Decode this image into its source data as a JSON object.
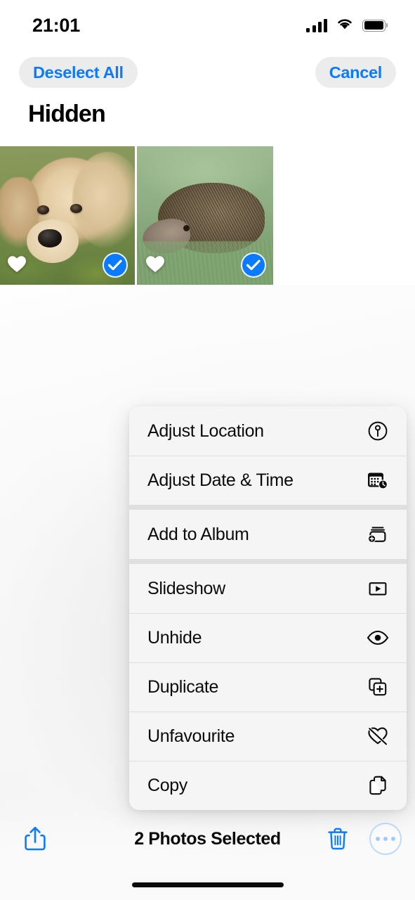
{
  "status_bar": {
    "time": "21:01",
    "cellular_icon": "signal-bars-icon",
    "wifi_icon": "wifi-icon",
    "battery_icon": "battery-full-icon"
  },
  "navbar": {
    "deselect_all_label": "Deselect All",
    "cancel_label": "Cancel"
  },
  "page": {
    "title": "Hidden"
  },
  "photo_grid": {
    "photos": [
      {
        "subject": "golden retriever puppy lying on grass",
        "favourite": true,
        "favourite_icon": "heart-filled-icon",
        "selected": true,
        "selected_icon": "checkmark-circle-icon"
      },
      {
        "subject": "hedgehog foraging in green grass",
        "favourite": true,
        "favourite_icon": "heart-filled-icon",
        "selected": true,
        "selected_icon": "checkmark-circle-icon"
      }
    ]
  },
  "context_menu": {
    "groups": [
      {
        "items": [
          {
            "label": "Adjust Location",
            "icon": "location-pin-circle-icon"
          },
          {
            "label": "Adjust Date & Time",
            "icon": "calendar-clock-icon"
          }
        ]
      },
      {
        "items": [
          {
            "label": "Add to Album",
            "icon": "add-to-album-icon"
          }
        ]
      },
      {
        "items": [
          {
            "label": "Slideshow",
            "icon": "play-rectangle-icon"
          },
          {
            "label": "Unhide",
            "icon": "eye-icon"
          },
          {
            "label": "Duplicate",
            "icon": "duplicate-plus-icon"
          },
          {
            "label": "Unfavourite",
            "icon": "heart-slash-icon"
          },
          {
            "label": "Copy",
            "icon": "copy-documents-icon"
          }
        ]
      }
    ]
  },
  "toolbar": {
    "share_icon": "share-upload-icon",
    "selection_count_label": "2 Photos Selected",
    "trash_icon": "trash-icon",
    "more_icon": "ellipsis-circle-icon"
  },
  "colors": {
    "accent_blue": "#0a7bff",
    "menu_background": "#f5f5f5",
    "pill_background": "#ececed",
    "text_primary": "#0b0b0b"
  }
}
